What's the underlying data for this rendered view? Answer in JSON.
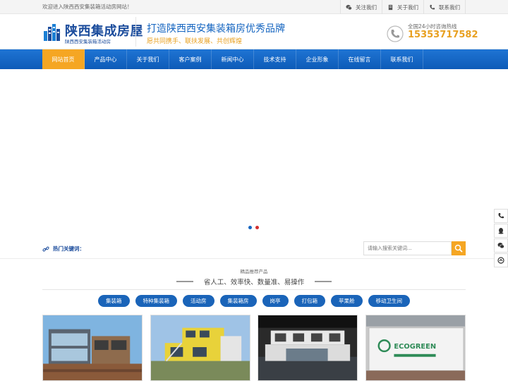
{
  "topbar": {
    "welcome": "欢迎进入陕西西安集装箱活动房网站！",
    "links": [
      "关注我们",
      "关于我们",
      "联系我们"
    ]
  },
  "logo": {
    "name": "陕西集成房屋",
    "sub": "陕西西安集装箱活动房"
  },
  "slogan": {
    "main": "打造陕西西安集装箱房优秀品牌",
    "sub": "愿共同携手、联扶发展、共创辉煌"
  },
  "hotline": {
    "label": "全国24小时咨询热线",
    "number": "15353717582"
  },
  "nav": [
    "网站首页",
    "产品中心",
    "关于我们",
    "客户案例",
    "新闻中心",
    "技术支持",
    "企业形象",
    "在线留言",
    "联系我们"
  ],
  "search": {
    "hot_label": "热门关键词：",
    "placeholder": "请输入搜索关键词..."
  },
  "products": {
    "kicker": "精品推荐产品",
    "title": "省人工、效率快、数量准、易操作",
    "categories": [
      "集装箱",
      "特种集装箱",
      "活动房",
      "集装箱房",
      "岗亭",
      "打包箱",
      "苹果舱",
      "移动卫生间"
    ]
  },
  "colors": {
    "brand": "#1b4c9c",
    "nav": "#1565c0",
    "accent": "#f5a623",
    "dot_active": "#d32f2f",
    "dot_inactive": "#1565c0"
  },
  "icons": [
    "wechat-icon",
    "book-icon",
    "phone-icon",
    "link-icon",
    "search-icon",
    "qq-icon",
    "top-icon"
  ]
}
